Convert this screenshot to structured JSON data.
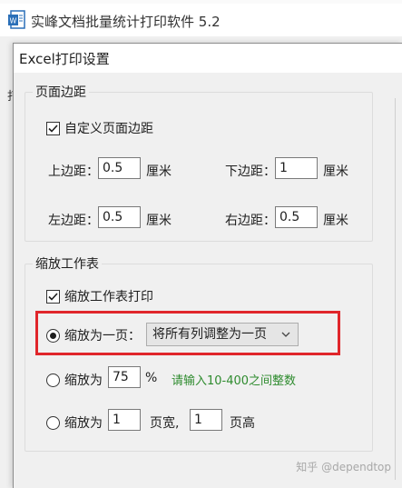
{
  "app": {
    "title": "实峰文档批量统计打印软件 5.2",
    "bg_tabs": [
      "",
      "",
      ""
    ],
    "bg_label": "打"
  },
  "dialog": {
    "title": "Excel打印设置",
    "margins": {
      "legend": "页面边距",
      "custom_label": "自定义页面边距",
      "custom_checked": true,
      "top": {
        "label": "上边距：",
        "value": "0.5",
        "unit": "厘米"
      },
      "bottom": {
        "label": "下边距：",
        "value": "1",
        "unit": "厘米"
      },
      "left": {
        "label": "左边距：",
        "value": "0.5",
        "unit": "厘米"
      },
      "right": {
        "label": "右边距：",
        "value": "0.5",
        "unit": "厘米"
      }
    },
    "scale": {
      "legend": "缩放工作表",
      "print_label": "缩放工作表打印",
      "print_checked": true,
      "fit_one": {
        "label": "缩放为一页：",
        "selected": true,
        "option": "将所有列调整为一页"
      },
      "percent": {
        "label": "缩放为",
        "value": "75",
        "unit": "%",
        "hint": "请输入10-400之间整数"
      },
      "pages": {
        "label": "缩放为",
        "wide_value": "1",
        "wide_unit": "页宽,",
        "tall_value": "1",
        "tall_unit": "页高"
      }
    }
  },
  "watermark": "知乎 @dependtop",
  "colors": {
    "highlight": "#e0262b",
    "hint": "#2e8b2e"
  }
}
